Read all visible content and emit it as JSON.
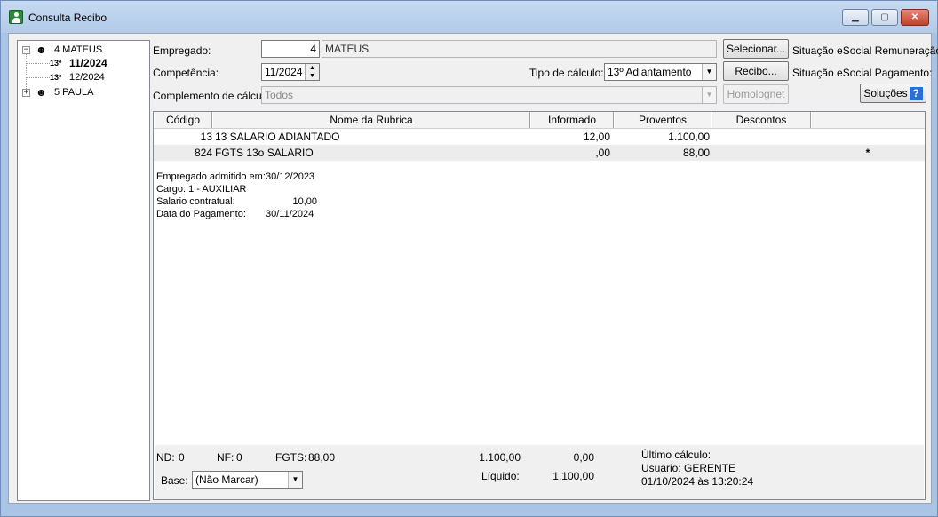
{
  "window": {
    "title": "Consulta Recibo",
    "minimize_icon": "minimize-icon",
    "maximize_icon": "maximize-icon",
    "close_icon": "close-icon"
  },
  "tree": {
    "nodes": [
      {
        "expander": "−",
        "label": "4 MATEUS",
        "icon": "person-icon"
      },
      {
        "label": "11/2024",
        "icon": "thirteenth-icon",
        "selected": true
      },
      {
        "label": "12/2024",
        "icon": "thirteenth-icon"
      },
      {
        "expander": "+",
        "label": "5 PAULA",
        "icon": "person-icon"
      }
    ],
    "thirteenth_glyph": "13º"
  },
  "form": {
    "empregado_label": "Empregado:",
    "empregado_code": "4",
    "empregado_name": "MATEUS",
    "competencia_label": "Competência:",
    "competencia_value": "11/2024",
    "tipo_calculo_label": "Tipo de cálculo:",
    "tipo_calculo_value": "13º Adiantamento",
    "complemento_label": "Complemento de cálculo:",
    "complemento_value": "Todos"
  },
  "buttons": {
    "selecionar": "Selecionar...",
    "recibo": "Recibo...",
    "homolognet": "Homolognet",
    "solucoes": "Soluções"
  },
  "status": {
    "remuneracao_label": "Situação eSocial Remuneração:",
    "pagamento_label": "Situação eSocial Pagamento:"
  },
  "grid": {
    "columns": [
      "Código",
      "Nome da Rubrica",
      "Informado",
      "Proventos",
      "Descontos"
    ],
    "rows": [
      {
        "codigo": "13",
        "nome": "13 SALARIO ADIANTADO",
        "informado": "12,00",
        "proventos": "1.100,00",
        "descontos": "",
        "flag": ""
      },
      {
        "codigo": "824",
        "nome": "FGTS 13o SALARIO",
        "informado": ",00",
        "proventos": "88,00",
        "descontos": "",
        "flag": "*"
      }
    ]
  },
  "info": {
    "admitido_label": "Empregado admitido em:",
    "admitido_value": "30/12/2023",
    "cargo": "Cargo: 1 - AUXILIAR",
    "salario_label": "Salario contratual:",
    "salario_value": "10,00",
    "pagamento_label": "Data do Pagamento:",
    "pagamento_value": "30/11/2024"
  },
  "footer": {
    "nd_label": "ND:",
    "nd_value": "0",
    "nf_label": "NF:",
    "nf_value": "0",
    "fgts_label": "FGTS:",
    "fgts_value": "88,00",
    "total_proventos": "1.100,00",
    "total_descontos": "0,00",
    "liquido_label": "Líquido:",
    "liquido_value": "1.100,00",
    "base_label": "Base:",
    "base_value": "(Não Marcar)",
    "ultimo_calculo_label": "Último cálculo:",
    "usuario": "Usuário: GERENTE",
    "data_calculo": "01/10/2024 às 13:20:24"
  }
}
